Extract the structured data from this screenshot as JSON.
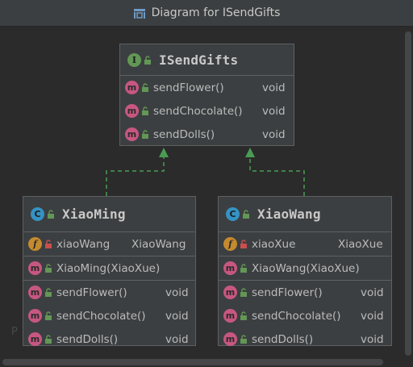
{
  "window": {
    "title": "Diagram for ISendGifts",
    "title_icon": "diagram-icon"
  },
  "colors": {
    "background": "#2b2b2b",
    "node_fill": "#3c3f41",
    "node_border": "#5e6060",
    "edge": "#499c54",
    "interface_badge": "#629755",
    "class_badge": "#3592c4",
    "method_badge": "#c75780",
    "field_badge": "#c58a2f",
    "public_lock": "#629755",
    "private_lock": "#c94f4f"
  },
  "interface_node": {
    "badge": "I",
    "name": "ISendGifts",
    "methods": [
      {
        "badge": "m",
        "name": "sendFlower()",
        "type": "void"
      },
      {
        "badge": "m",
        "name": "sendChocolate()",
        "type": "void"
      },
      {
        "badge": "m",
        "name": "sendDolls()",
        "type": "void"
      }
    ]
  },
  "class_nodes": [
    {
      "badge": "C",
      "name": "XiaoMing",
      "field": {
        "badge": "f",
        "name": "xiaoWang",
        "type": "XiaoWang"
      },
      "constructor": {
        "badge": "m",
        "name": "XiaoMing(XiaoXue)"
      },
      "methods": [
        {
          "badge": "m",
          "name": "sendFlower()",
          "type": "void"
        },
        {
          "badge": "m",
          "name": "sendChocolate()",
          "type": "void"
        },
        {
          "badge": "m",
          "name": "sendDolls()",
          "type": "void"
        }
      ]
    },
    {
      "badge": "C",
      "name": "XiaoWang",
      "field": {
        "badge": "f",
        "name": "xiaoXue",
        "type": "XiaoXue"
      },
      "constructor": {
        "badge": "m",
        "name": "XiaoWang(XiaoXue)"
      },
      "methods": [
        {
          "badge": "m",
          "name": "sendFlower()",
          "type": "void"
        },
        {
          "badge": "m",
          "name": "sendChocolate()",
          "type": "void"
        },
        {
          "badge": "m",
          "name": "sendDolls()",
          "type": "void"
        }
      ]
    }
  ],
  "watermark": "P"
}
